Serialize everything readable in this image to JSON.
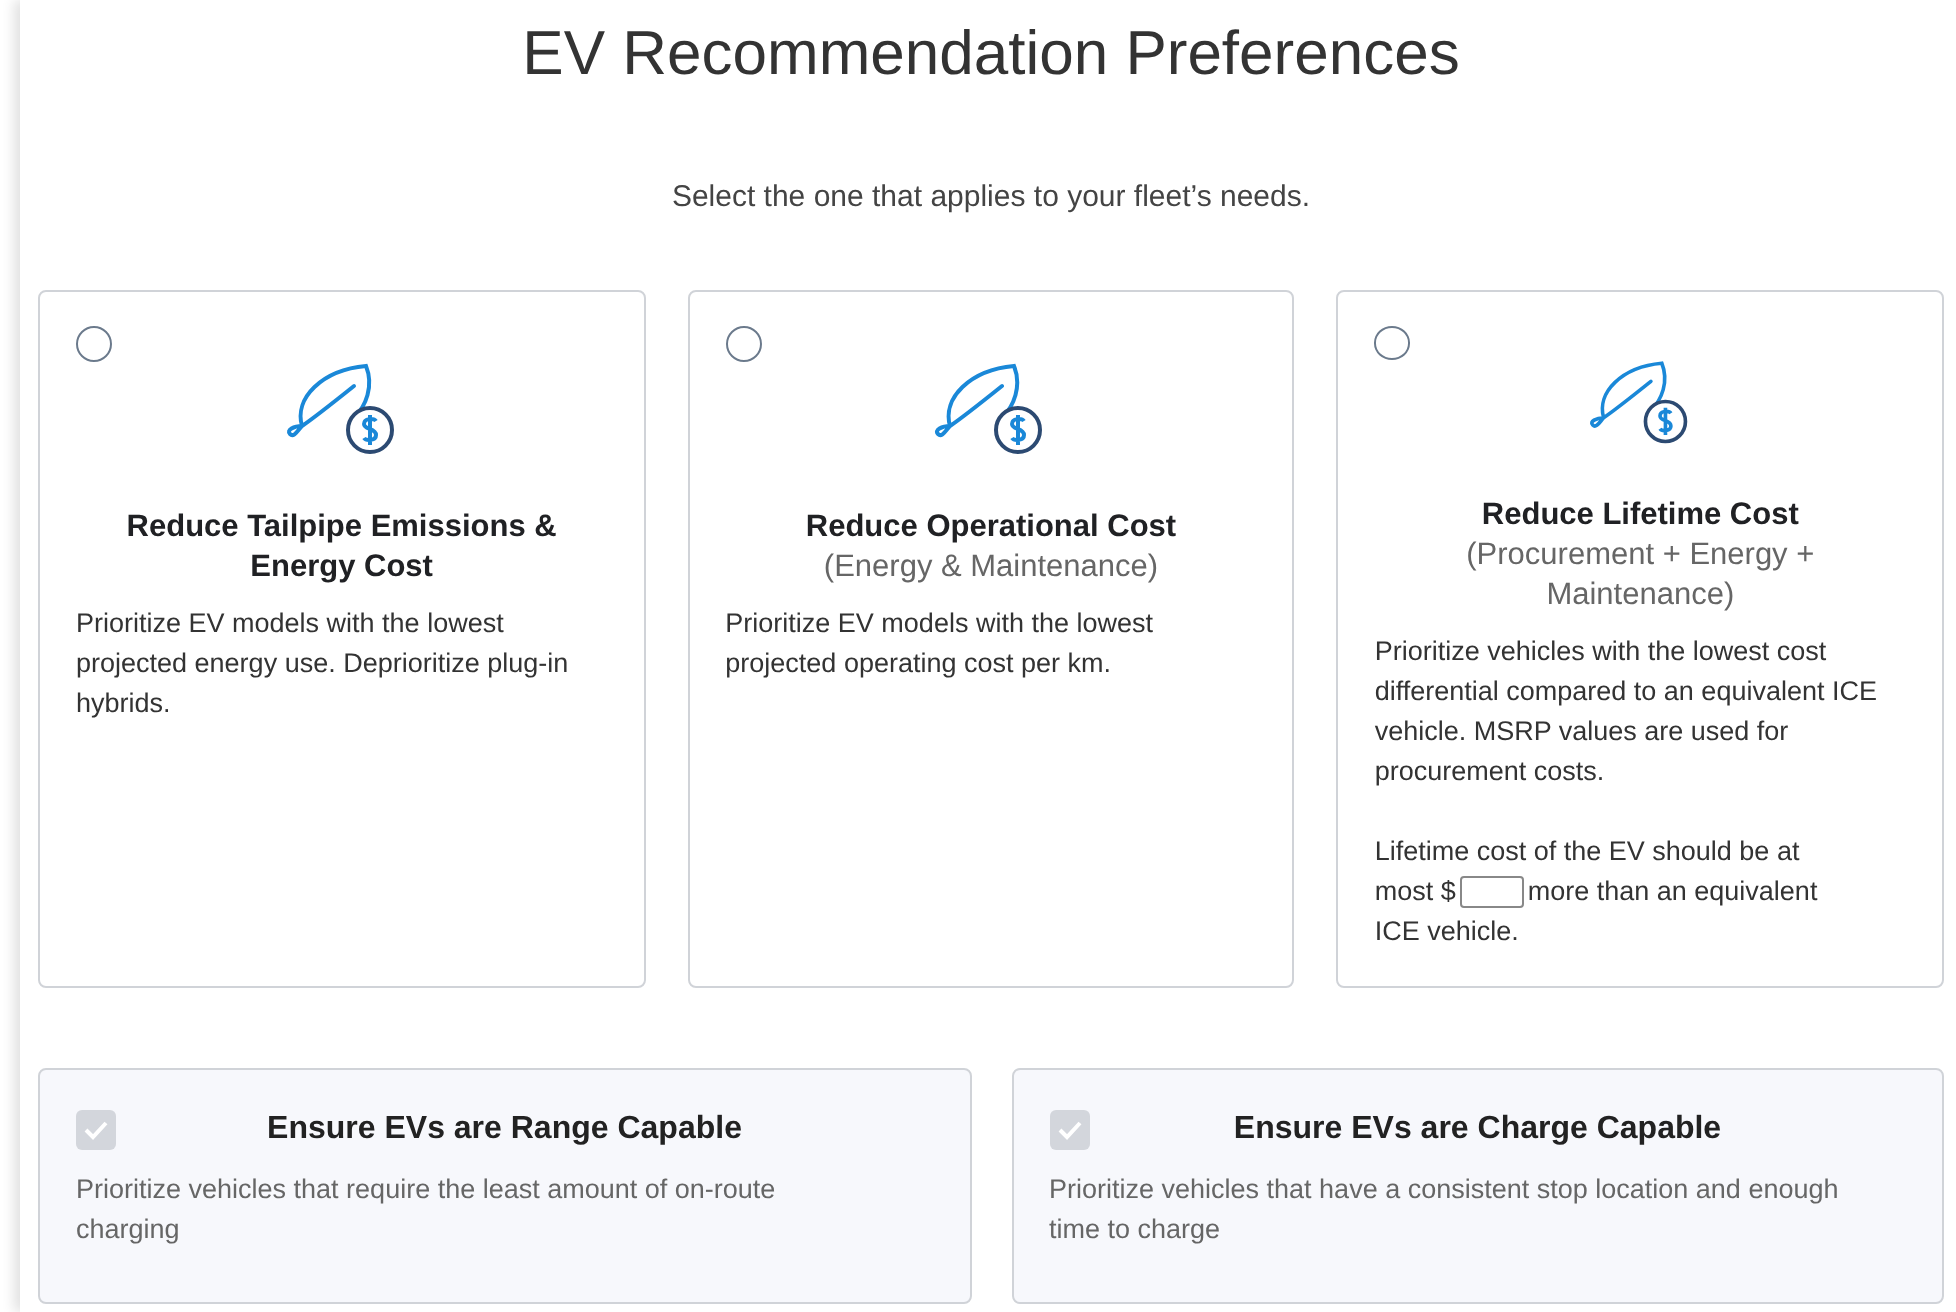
{
  "title": "EV Recommendation Preferences",
  "subtitle": "Select the one that applies to your fleet’s needs.",
  "options": [
    {
      "title": "Reduce Tailpipe Emissions & Energy Cost",
      "selected": false,
      "description": "Prioritize EV models with the lowest projected energy use. Deprioritize plug-in hybrids."
    },
    {
      "title": "Reduce Operational Cost",
      "subtitle": "(Energy & Maintenance)",
      "selected": false,
      "description": "Prioritize EV models with the lowest projected operating cost per km."
    },
    {
      "title": "Reduce Lifetime Cost",
      "subtitle": "(Procurement + Energy + Maintenance)",
      "selected": false,
      "description": "Prioritize vehicles with the lowest cost differential compared to an equivalent ICE vehicle. MSRP values are used for procurement costs.",
      "threshold": {
        "lead": "Lifetime cost of the EV should be at",
        "before": "most $",
        "after": "more than an equivalent",
        "tail": "ICE vehicle."
      }
    }
  ],
  "constraints": [
    {
      "title": "Ensure EVs are Range Capable",
      "checked": true,
      "disabled": true,
      "description": "Prioritize vehicles that require the least amount of on-route charging"
    },
    {
      "title": "Ensure EVs are Charge Capable",
      "checked": true,
      "disabled": true,
      "description": "Prioritize vehicles that have a consistent stop location and enough time to charge"
    }
  ]
}
